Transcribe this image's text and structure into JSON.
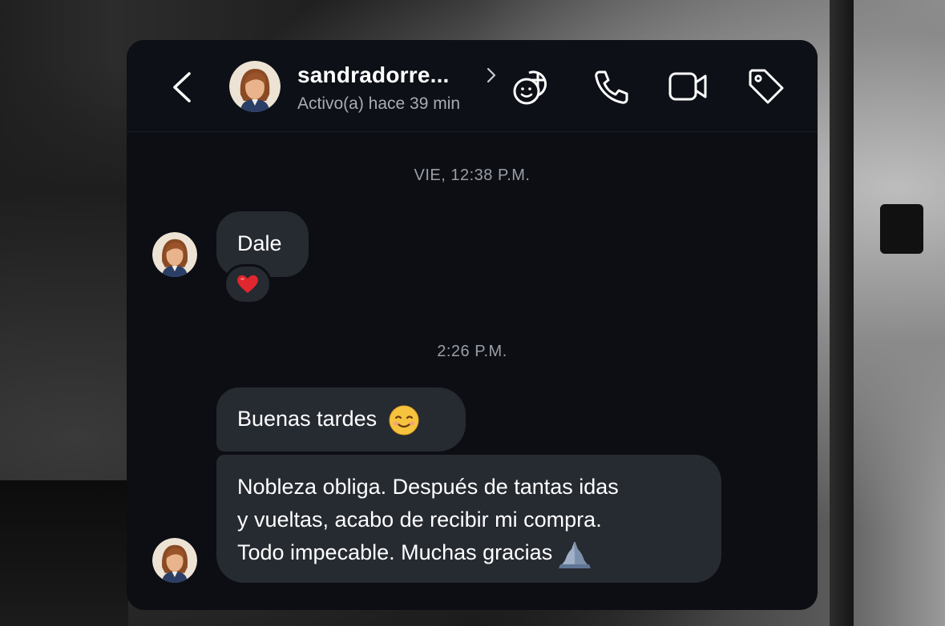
{
  "contact": {
    "username": "sandradorre...",
    "status": "Activo(a) hace 39 min"
  },
  "header_icons": [
    "back-icon",
    "chevron-right-icon",
    "add-members-icon",
    "phone-icon",
    "video-icon",
    "tag-icon"
  ],
  "messages": {
    "timestamp_1": "VIE, 12:38 P.M.",
    "msg_dale": "Dale",
    "reaction_dale": "heart",
    "timestamp_2": "2:26 P.M.",
    "msg_tardes": "Buenas tardes",
    "msg_long_line1": "Nobleza obliga. Después de tantas idas",
    "msg_long_line2": "y vueltas, acabo de recibir mi compra.",
    "msg_long_line3": "Todo impecable. Muchas gracias"
  },
  "colors": {
    "panel_bg": "#0c0e14",
    "bubble_bg": "#262a31",
    "text_primary": "#ffffff",
    "text_secondary": "#a7abb3",
    "heart": "#e0262f"
  }
}
